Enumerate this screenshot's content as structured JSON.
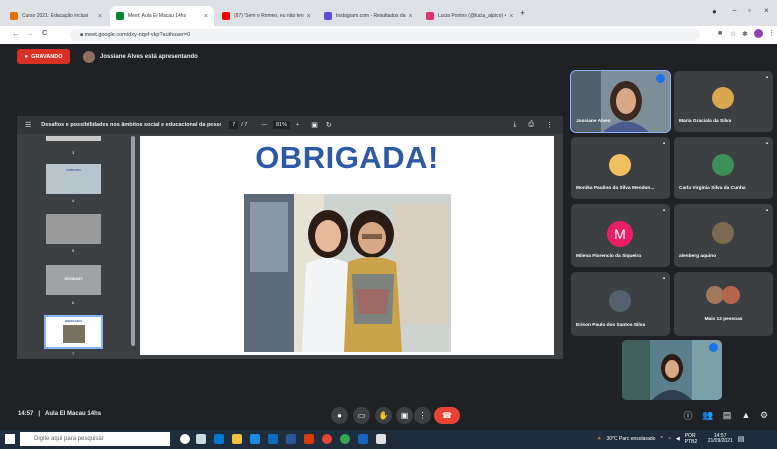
{
  "browser": {
    "tabs": [
      {
        "label": "Curso 2021: Educação inclusi",
        "color": "#e37400"
      },
      {
        "label": "Meet: Aula El Macau 14hs",
        "color": "#00832d"
      },
      {
        "label": "(87) 'Sem o Romeo, eu não ten",
        "color": "#ff0000"
      },
      {
        "label": "Instagram.com - Resultados da",
        "color": "#5b51d8"
      },
      {
        "label": "Lucia Pontes (@lucia_atpico) •",
        "color": "#e1306c"
      }
    ],
    "new_tab": "+",
    "url": "meet.google.com/dxy-nqsf-vkp?authuser=0",
    "nav": {
      "back": "←",
      "forward": "→",
      "reload": "C",
      "lock": "🔒"
    }
  },
  "meet": {
    "recording_label": "GRAVANDO",
    "presenter_text": "Jossiane Alves está apresentando",
    "meeting_time": "14:57",
    "meeting_name": "Aula El Macau 14hs"
  },
  "viewer": {
    "doc_title": "Desafios e possibilidades nos âmbitos social e educacional da pessoa...",
    "page_current": "7",
    "page_total": "/ 7",
    "zoom": "81%",
    "zoom_minus": "—",
    "zoom_plus": "+",
    "thumbnails": [
      {
        "number": "3",
        "label": ""
      },
      {
        "number": "4",
        "label": "CONTATO"
      },
      {
        "number": "5",
        "label": ""
      },
      {
        "number": "6",
        "label": "DÚVIDAS?"
      },
      {
        "number": "7",
        "label": "OBRIGADA!"
      }
    ],
    "slide_title": "OBRIGADA!"
  },
  "participants": [
    {
      "name": "Jossiane Alves",
      "type": "video"
    },
    {
      "name": "Maria Graciala da Silva",
      "type": "photo",
      "color": "#d9a84e"
    },
    {
      "name": "Monika Paulino da Silva Mendon...",
      "type": "photo",
      "color": "#f0c060"
    },
    {
      "name": "Carla Virgínia Silva da Cunha",
      "type": "photo",
      "color": "#3f8f5a"
    },
    {
      "name": "Milena Florencio da Siqueira",
      "type": "letter",
      "letter": "M"
    },
    {
      "name": "alenberg aquino",
      "type": "photo",
      "color": "#7a6a4f"
    },
    {
      "name": "Erison Paulo dos Santos Silva",
      "type": "photo",
      "color": "#556070"
    },
    {
      "name": "Mais 12 pessoas",
      "type": "group"
    }
  ],
  "taskbar": {
    "search_placeholder": "Digite aqui para pesquisar",
    "weather": "30°C Parc ensolarado",
    "lang": "POR PTB2",
    "time": "14:57",
    "date": "21/09/2021"
  }
}
